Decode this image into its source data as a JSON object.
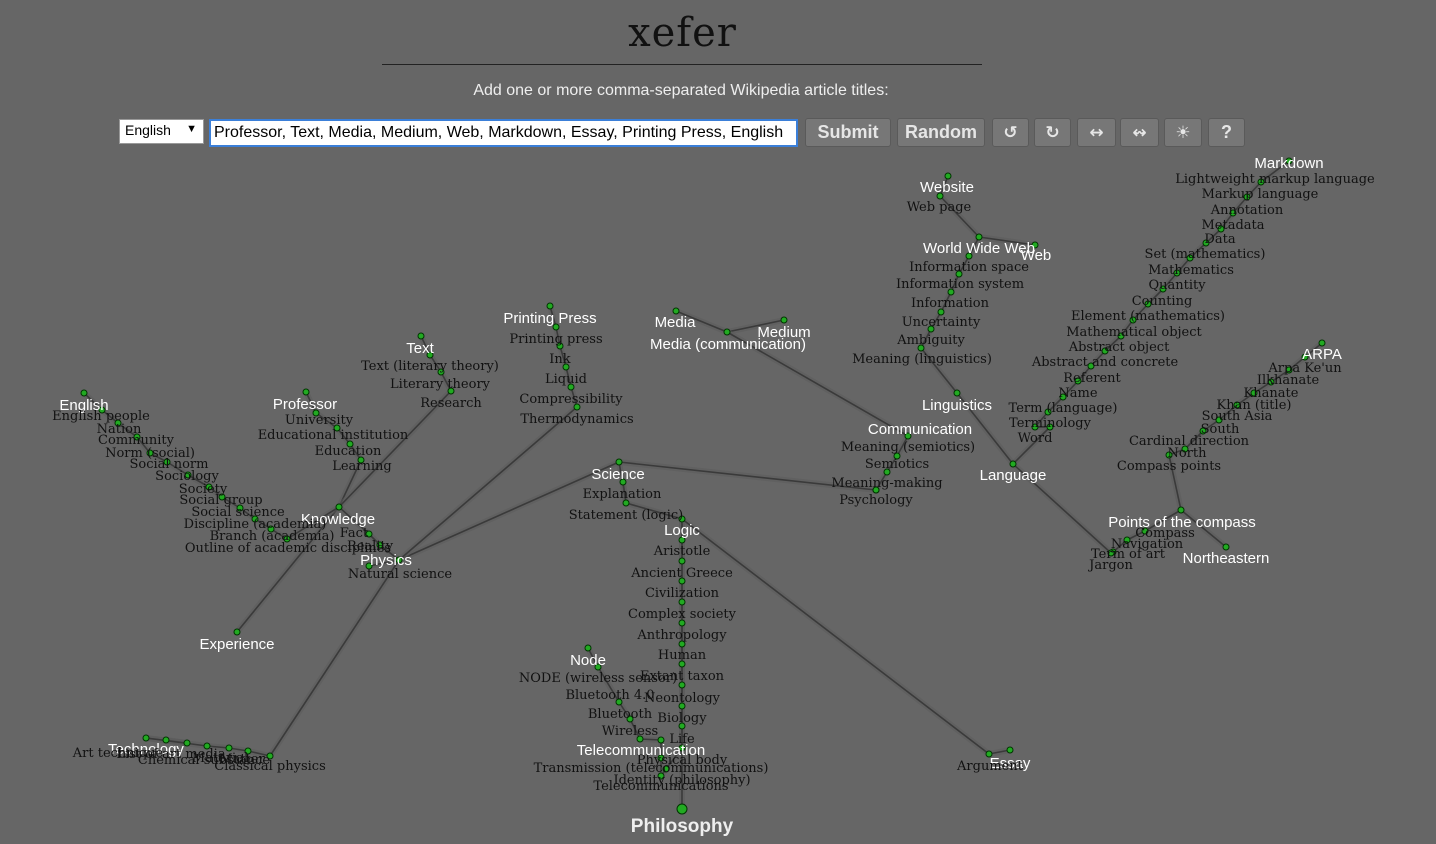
{
  "header": {
    "logo": "xefer",
    "subtitle": "Add one or more comma-separated Wikipedia article titles:"
  },
  "controls": {
    "language": "English",
    "query": "Professor, Text, Media, Medium, Web, Markdown, Essay, Printing Press, English",
    "submit_label": "Submit",
    "random_label": "Random",
    "undo_icon": "↺",
    "redo_icon": "↻",
    "expand_icon": "↔",
    "compress_icon": "↭",
    "theme_icon": "☀",
    "help_label": "?"
  },
  "graph": {
    "main_label": "Philosophy",
    "nodes": [
      {
        "id": "Philosophy",
        "label": "Philosophy",
        "root": false
      },
      {
        "id": "Logic",
        "label": "Logic",
        "root": true
      },
      {
        "id": "Aristotle",
        "label": "Aristotle"
      },
      {
        "id": "Ancient Greece",
        "label": "Ancient Greece"
      },
      {
        "id": "Civilization",
        "label": "Civilization"
      },
      {
        "id": "Complex society",
        "label": "Complex society"
      },
      {
        "id": "Anthropology",
        "label": "Anthropology"
      },
      {
        "id": "Human",
        "label": "Human"
      },
      {
        "id": "Extant taxon",
        "label": "Extant taxon"
      },
      {
        "id": "Neontology",
        "label": "Neontology"
      },
      {
        "id": "Biology",
        "label": "Biology"
      },
      {
        "id": "Life",
        "label": "Life"
      },
      {
        "id": "Physical body",
        "label": "Physical body"
      },
      {
        "id": "Identity (philosophy)",
        "label": "Identity (philosophy)"
      },
      {
        "id": "Science",
        "label": "Science",
        "root": true
      },
      {
        "id": "Explanation",
        "label": "Explanation"
      },
      {
        "id": "Statement (logic)",
        "label": "Statement (logic)"
      },
      {
        "id": "Node",
        "label": "Node",
        "root": true
      },
      {
        "id": "NODE (wireless sensor)",
        "label": "NODE (wireless sensor)"
      },
      {
        "id": "Bluetooth 4.0",
        "label": "Bluetooth 4.0"
      },
      {
        "id": "Bluetooth",
        "label": "Bluetooth"
      },
      {
        "id": "Wireless",
        "label": "Wireless"
      },
      {
        "id": "Telecommunication",
        "label": "Telecommunication",
        "root": true
      },
      {
        "id": "Transmission (telecommunications)",
        "label": "Transmission (telecommunications)"
      },
      {
        "id": "Telecommunications",
        "label": "Telecommunications"
      },
      {
        "id": "Essay",
        "label": "Essay",
        "root": true
      },
      {
        "id": "Argument",
        "label": "Argument"
      },
      {
        "id": "Physics",
        "label": "Physics",
        "root": true
      },
      {
        "id": "Natural science",
        "label": "Natural science"
      },
      {
        "id": "Knowledge",
        "label": "Knowledge",
        "root": true
      },
      {
        "id": "Fact",
        "label": "Fact"
      },
      {
        "id": "Reality",
        "label": "Reality"
      },
      {
        "id": "Experience",
        "label": "Experience",
        "root": true
      },
      {
        "id": "Professor",
        "label": "Professor",
        "root": true
      },
      {
        "id": "University",
        "label": "University"
      },
      {
        "id": "Educational institution",
        "label": "Educational institution"
      },
      {
        "id": "Education",
        "label": "Education"
      },
      {
        "id": "Learning",
        "label": "Learning"
      },
      {
        "id": "Text",
        "label": "Text",
        "root": true
      },
      {
        "id": "Text (literary theory)",
        "label": "Text (literary theory)"
      },
      {
        "id": "Literary theory",
        "label": "Literary theory"
      },
      {
        "id": "Research",
        "label": "Research"
      },
      {
        "id": "Printing Press",
        "label": "Printing Press",
        "root": true
      },
      {
        "id": "Printing press",
        "label": "Printing press"
      },
      {
        "id": "Ink",
        "label": "Ink"
      },
      {
        "id": "Liquid",
        "label": "Liquid"
      },
      {
        "id": "Compressibility",
        "label": "Compressibility"
      },
      {
        "id": "Thermodynamics",
        "label": "Thermodynamics"
      },
      {
        "id": "English",
        "label": "English",
        "root": true
      },
      {
        "id": "English people",
        "label": "English people"
      },
      {
        "id": "Nation",
        "label": "Nation"
      },
      {
        "id": "Community",
        "label": "Community"
      },
      {
        "id": "Norm (social)",
        "label": "Norm (social)"
      },
      {
        "id": "Social norm",
        "label": "Social norm"
      },
      {
        "id": "Sociology",
        "label": "Sociology"
      },
      {
        "id": "Society",
        "label": "Society"
      },
      {
        "id": "Social group",
        "label": "Social group"
      },
      {
        "id": "Social science",
        "label": "Social science"
      },
      {
        "id": "Discipline (academia)",
        "label": "Discipline (academia)"
      },
      {
        "id": "Branch (academia)",
        "label": "Branch (academia)"
      },
      {
        "id": "Outline of academic disciplines",
        "label": "Outline of academic disciplines"
      },
      {
        "id": "Technology",
        "label": "Technology",
        "root": true
      },
      {
        "id": "Art technique",
        "label": "Art technique"
      },
      {
        "id": "List of art media",
        "label": "List of art media"
      },
      {
        "id": "Chemical substance",
        "label": "Chemical substance"
      },
      {
        "id": "Material",
        "label": "Material"
      },
      {
        "id": "Matter",
        "label": "Matter"
      },
      {
        "id": "Classical physics",
        "label": "Classical physics"
      },
      {
        "id": "Media",
        "label": "Media",
        "root": true
      },
      {
        "id": "Medium",
        "label": "Medium",
        "root": true
      },
      {
        "id": "Media (communication)",
        "label": "Media (communication)",
        "root": true
      },
      {
        "id": "Communication",
        "label": "Communication",
        "root": true
      },
      {
        "id": "Meaning (semiotics)",
        "label": "Meaning (semiotics)"
      },
      {
        "id": "Semiotics",
        "label": "Semiotics"
      },
      {
        "id": "Meaning-making",
        "label": "Meaning-making"
      },
      {
        "id": "Psychology",
        "label": "Psychology"
      },
      {
        "id": "Linguistics",
        "label": "Linguistics",
        "root": true
      },
      {
        "id": "Language",
        "label": "Language",
        "root": true
      },
      {
        "id": "Website",
        "label": "Website",
        "root": true
      },
      {
        "id": "Web page",
        "label": "Web page"
      },
      {
        "id": "World Wide Web",
        "label": "World Wide Web",
        "root": true
      },
      {
        "id": "Web",
        "label": "Web",
        "root": true
      },
      {
        "id": "Information space",
        "label": "Information space"
      },
      {
        "id": "Information system",
        "label": "Information system"
      },
      {
        "id": "Information",
        "label": "Information"
      },
      {
        "id": "Uncertainty",
        "label": "Uncertainty"
      },
      {
        "id": "Ambiguity",
        "label": "Ambiguity"
      },
      {
        "id": "Meaning (linguistics)",
        "label": "Meaning (linguistics)"
      },
      {
        "id": "Markdown",
        "label": "Markdown",
        "root": true
      },
      {
        "id": "Lightweight markup language",
        "label": "Lightweight markup language"
      },
      {
        "id": "Markup language",
        "label": "Markup language"
      },
      {
        "id": "Annotation",
        "label": "Annotation"
      },
      {
        "id": "Metadata",
        "label": "Metadata"
      },
      {
        "id": "Data",
        "label": "Data"
      },
      {
        "id": "Set (mathematics)",
        "label": "Set (mathematics)"
      },
      {
        "id": "Mathematics",
        "label": "Mathematics"
      },
      {
        "id": "Quantity",
        "label": "Quantity"
      },
      {
        "id": "Counting",
        "label": "Counting"
      },
      {
        "id": "Element (mathematics)",
        "label": "Element (mathematics)"
      },
      {
        "id": "Mathematical object",
        "label": "Mathematical object"
      },
      {
        "id": "Abstract object",
        "label": "Abstract object"
      },
      {
        "id": "Abstract and concrete",
        "label": "Abstract and concrete"
      },
      {
        "id": "Referent",
        "label": "Referent"
      },
      {
        "id": "Name",
        "label": "Name"
      },
      {
        "id": "Term (language)",
        "label": "Term (language)"
      },
      {
        "id": "Terminology",
        "label": "Terminology"
      },
      {
        "id": "Word",
        "label": "Word"
      },
      {
        "id": "ARPA",
        "label": "ARPA",
        "root": true
      },
      {
        "id": "Arpa Ke'un",
        "label": "Arpa Ke'un"
      },
      {
        "id": "Ilkhanate",
        "label": "Ilkhanate"
      },
      {
        "id": "Khanate",
        "label": "Khanate"
      },
      {
        "id": "Khan (title)",
        "label": "Khan (title)"
      },
      {
        "id": "South Asia",
        "label": "South Asia"
      },
      {
        "id": "South",
        "label": "South"
      },
      {
        "id": "Cardinal direction",
        "label": "Cardinal direction"
      },
      {
        "id": "North",
        "label": "North"
      },
      {
        "id": "Compass points",
        "label": "Compass points"
      },
      {
        "id": "Points of the compass",
        "label": "Points of the compass",
        "root": true
      },
      {
        "id": "Compass",
        "label": "Compass"
      },
      {
        "id": "Navigation",
        "label": "Navigation"
      },
      {
        "id": "Term of art",
        "label": "Term of art"
      },
      {
        "id": "Jargon",
        "label": "Jargon"
      },
      {
        "id": "Northeastern",
        "label": "Northeastern",
        "root": true
      }
    ],
    "edges": [
      [
        "Logic",
        "Philosophy"
      ],
      [
        "Aristotle",
        "Logic"
      ],
      [
        "Ancient Greece",
        "Aristotle"
      ],
      [
        "Civilization",
        "Ancient Greece"
      ],
      [
        "Complex society",
        "Civilization"
      ],
      [
        "Anthropology",
        "Complex society"
      ],
      [
        "Human",
        "Anthropology"
      ],
      [
        "Extant taxon",
        "Human"
      ],
      [
        "Neontology",
        "Extant taxon"
      ],
      [
        "Biology",
        "Neontology"
      ],
      [
        "Life",
        "Biology"
      ],
      [
        "Physical body",
        "Life"
      ],
      [
        "Identity (philosophy)",
        "Physical body"
      ],
      [
        "Science",
        "Statement (logic)"
      ],
      [
        "Explanation",
        "Statement (logic)"
      ],
      [
        "Statement (logic)",
        "Logic"
      ],
      [
        "Node",
        "NODE (wireless sensor)"
      ],
      [
        "NODE (wireless sensor)",
        "Bluetooth 4.0"
      ],
      [
        "Bluetooth 4.0",
        "Bluetooth"
      ],
      [
        "Bluetooth",
        "Wireless"
      ],
      [
        "Wireless",
        "Telecommunication"
      ],
      [
        "Telecommunication",
        "Transmission (telecommunications)"
      ],
      [
        "Transmission (telecommunications)",
        "Telecommunications"
      ],
      [
        "Telecommunications",
        "Identity (philosophy)"
      ],
      [
        "Essay",
        "Argument"
      ],
      [
        "Argument",
        "Logic"
      ],
      [
        "Physics",
        "Science"
      ],
      [
        "Natural science",
        "Physics"
      ],
      [
        "Knowledge",
        "Fact"
      ],
      [
        "Fact",
        "Reality"
      ],
      [
        "Reality",
        "Physics"
      ],
      [
        "Experience",
        "Knowledge"
      ],
      [
        "Professor",
        "University"
      ],
      [
        "University",
        "Educational institution"
      ],
      [
        "Educational institution",
        "Education"
      ],
      [
        "Education",
        "Learning"
      ],
      [
        "Learning",
        "Knowledge"
      ],
      [
        "Text",
        "Text (literary theory)"
      ],
      [
        "Text (literary theory)",
        "Literary theory"
      ],
      [
        "Literary theory",
        "Research"
      ],
      [
        "Research",
        "Knowledge"
      ],
      [
        "Printing Press",
        "Printing press"
      ],
      [
        "Printing press",
        "Ink"
      ],
      [
        "Ink",
        "Liquid"
      ],
      [
        "Liquid",
        "Compressibility"
      ],
      [
        "Compressibility",
        "Thermodynamics"
      ],
      [
        "Thermodynamics",
        "Physics"
      ],
      [
        "English",
        "English people"
      ],
      [
        "English people",
        "Nation"
      ],
      [
        "Nation",
        "Community"
      ],
      [
        "Community",
        "Norm (social)"
      ],
      [
        "Norm (social)",
        "Social norm"
      ],
      [
        "Social norm",
        "Sociology"
      ],
      [
        "Sociology",
        "Society"
      ],
      [
        "Society",
        "Social group"
      ],
      [
        "Social group",
        "Social science"
      ],
      [
        "Social science",
        "Discipline (academia)"
      ],
      [
        "Discipline (academia)",
        "Branch (academia)"
      ],
      [
        "Branch (academia)",
        "Outline of academic disciplines"
      ],
      [
        "Outline of academic disciplines",
        "Knowledge"
      ],
      [
        "Art technique",
        "List of art media"
      ],
      [
        "List of art media",
        "Technology"
      ],
      [
        "Technology",
        "Chemical substance"
      ],
      [
        "Chemical substance",
        "Material"
      ],
      [
        "Material",
        "Matter"
      ],
      [
        "Matter",
        "Classical physics"
      ],
      [
        "Classical physics",
        "Physics"
      ],
      [
        "Media",
        "Media (communication)"
      ],
      [
        "Medium",
        "Media (communication)"
      ],
      [
        "Media (communication)",
        "Communication"
      ],
      [
        "Communication",
        "Meaning (semiotics)"
      ],
      [
        "Meaning (semiotics)",
        "Semiotics"
      ],
      [
        "Semiotics",
        "Meaning-making"
      ],
      [
        "Meaning-making",
        "Psychology"
      ],
      [
        "Psychology",
        "Science"
      ],
      [
        "Linguistics",
        "Language"
      ],
      [
        "Language",
        "Jargon"
      ],
      [
        "Website",
        "Web page"
      ],
      [
        "Web page",
        "World Wide Web"
      ],
      [
        "Web",
        "World Wide Web"
      ],
      [
        "World Wide Web",
        "Information space"
      ],
      [
        "Information space",
        "Information system"
      ],
      [
        "Information system",
        "Information"
      ],
      [
        "Information",
        "Uncertainty"
      ],
      [
        "Uncertainty",
        "Ambiguity"
      ],
      [
        "Ambiguity",
        "Meaning (linguistics)"
      ],
      [
        "Meaning (linguistics)",
        "Linguistics"
      ],
      [
        "Markdown",
        "Lightweight markup language"
      ],
      [
        "Lightweight markup language",
        "Markup language"
      ],
      [
        "Markup language",
        "Annotation"
      ],
      [
        "Annotation",
        "Metadata"
      ],
      [
        "Metadata",
        "Data"
      ],
      [
        "Data",
        "Set (mathematics)"
      ],
      [
        "Set (mathematics)",
        "Mathematics"
      ],
      [
        "Mathematics",
        "Quantity"
      ],
      [
        "Quantity",
        "Counting"
      ],
      [
        "Counting",
        "Element (mathematics)"
      ],
      [
        "Element (mathematics)",
        "Mathematical object"
      ],
      [
        "Mathematical object",
        "Abstract object"
      ],
      [
        "Abstract object",
        "Abstract and concrete"
      ],
      [
        "Abstract and concrete",
        "Referent"
      ],
      [
        "Referent",
        "Name"
      ],
      [
        "Name",
        "Term (language)"
      ],
      [
        "Term (language)",
        "Terminology"
      ],
      [
        "Terminology",
        "Word"
      ],
      [
        "Word",
        "Language"
      ],
      [
        "ARPA",
        "Arpa Ke'un"
      ],
      [
        "Arpa Ke'un",
        "Ilkhanate"
      ],
      [
        "Ilkhanate",
        "Khanate"
      ],
      [
        "Khanate",
        "Khan (title)"
      ],
      [
        "Khan (title)",
        "South Asia"
      ],
      [
        "South Asia",
        "South"
      ],
      [
        "South",
        "Cardinal direction"
      ],
      [
        "Cardinal direction",
        "North"
      ],
      [
        "North",
        "Compass points"
      ],
      [
        "Compass points",
        "Points of the compass"
      ],
      [
        "Points of the compass",
        "Compass"
      ],
      [
        "Compass",
        "Navigation"
      ],
      [
        "Navigation",
        "Term of art"
      ],
      [
        "Term of art",
        "Jargon"
      ],
      [
        "Northeastern",
        "Points of the compass"
      ]
    ]
  }
}
